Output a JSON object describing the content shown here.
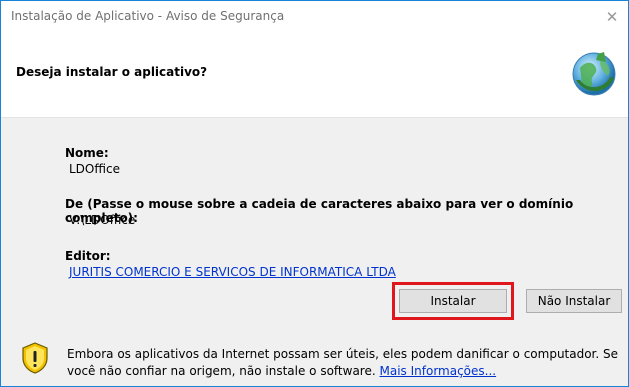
{
  "window": {
    "title": "Instalação de Aplicativo - Aviso de Segurança",
    "close_glyph": "✕"
  },
  "header": {
    "question": "Deseja instalar o aplicativo?",
    "icon": "globe-install-icon"
  },
  "details": {
    "name_label": "Nome:",
    "name_value": "LDOffice",
    "from_label": "De (Passe o mouse sobre a cadeia de caracteres abaixo para ver o domínio completo):",
    "from_value": "V:\\LDOffice",
    "publisher_label": "Editor:",
    "publisher_value": "JURITIS COMERCIO E SERVICOS DE INFORMATICA LTDA"
  },
  "buttons": {
    "install": "Instalar",
    "dont_install": "Não Instalar"
  },
  "footer": {
    "icon": "warning-shield-icon",
    "text": "Embora os aplicativos da Internet possam ser úteis, eles podem danificar o computador. Se você não confiar na origem, não instale o software.",
    "link": "Mais Informações..."
  },
  "colors": {
    "highlight": "#e0161d",
    "link": "#0033cc",
    "border": "#1883d7"
  }
}
